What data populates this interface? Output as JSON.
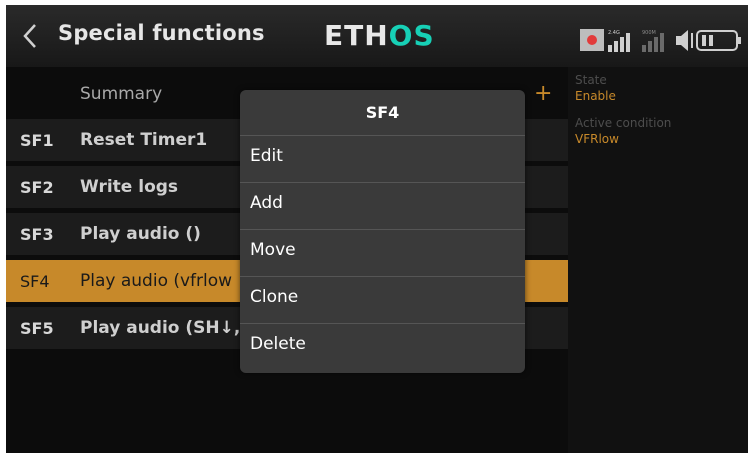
{
  "header": {
    "title": "Special functions",
    "logo_part1": "ETH",
    "logo_part2": "OS",
    "status": {
      "rx_label": "2.4G",
      "rx2_label": "900M"
    }
  },
  "list": {
    "summary_label": "Summary",
    "rows": [
      {
        "num": "SF1",
        "desc": "Reset Timer1"
      },
      {
        "num": "SF2",
        "desc": "Write logs"
      },
      {
        "num": "SF3",
        "desc": "Play audio ()"
      },
      {
        "num": "SF4",
        "desc": "Play audio (vfrlow"
      },
      {
        "num": "SF5",
        "desc": "Play audio (SH↓, t"
      }
    ]
  },
  "panel": {
    "state_label": "State",
    "state_value": "Enable",
    "condition_label": "Active condition",
    "condition_value": "VFRlow"
  },
  "popup": {
    "title": "SF4",
    "items": [
      "Edit",
      "Add",
      "Move",
      "Clone",
      "Delete"
    ]
  },
  "colors": {
    "accent": "#c7892a",
    "logo_green": "#17d0b6",
    "background": "#000000"
  }
}
